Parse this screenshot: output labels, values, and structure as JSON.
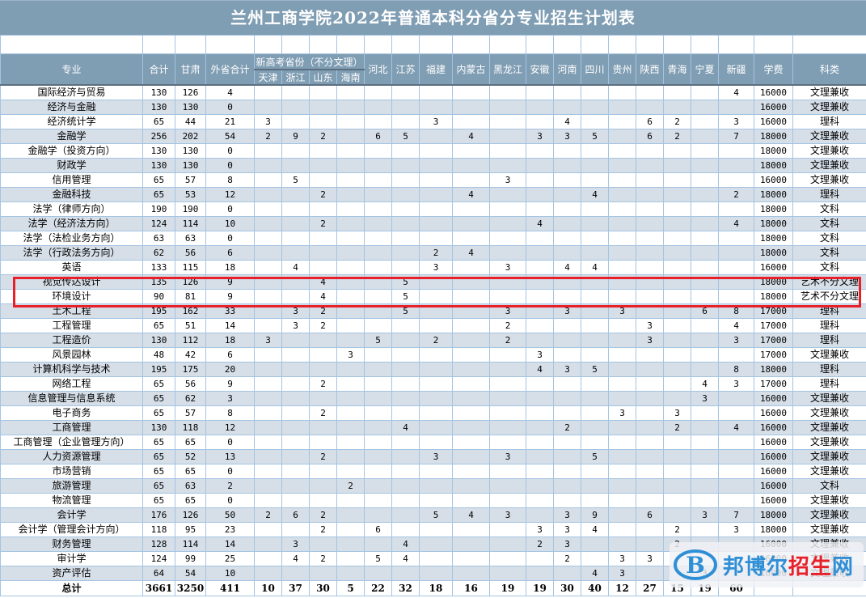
{
  "title": "兰州工商学院2022年普通本科分省分专业招生计划表",
  "headers": {
    "major": "专业",
    "total": "合计",
    "gansu": "甘肃",
    "out_total": "外省合计",
    "new_gaokao_group": "新高考省份（不分文理）",
    "new_gaokao_provinces": [
      "天津",
      "浙江",
      "山东",
      "海南"
    ],
    "other_provinces": [
      "河北",
      "江苏",
      "福建",
      "内蒙古",
      "黑龙江",
      "安徽",
      "河南",
      "四川",
      "贵州",
      "陕西",
      "青海",
      "宁夏",
      "新疆"
    ],
    "tuition": "学费",
    "category": "科类"
  },
  "province_order": [
    "天津",
    "浙江",
    "山东",
    "海南",
    "河北",
    "江苏",
    "福建",
    "内蒙古",
    "黑龙江",
    "安徽",
    "河南",
    "四川",
    "贵州",
    "陕西",
    "青海",
    "宁夏",
    "新疆"
  ],
  "rows": [
    {
      "major": "国际经济与贸易",
      "total": "130",
      "gansu": "126",
      "out_total": "4",
      "provinces": [
        "",
        "",
        "",
        "",
        "",
        "",
        "",
        "",
        "",
        "",
        "",
        "",
        "",
        "",
        "",
        "",
        "4"
      ],
      "tuition": "16000",
      "category": "文理兼收"
    },
    {
      "major": "经济与金融",
      "total": "130",
      "gansu": "130",
      "out_total": "0",
      "provinces": [
        "",
        "",
        "",
        "",
        "",
        "",
        "",
        "",
        "",
        "",
        "",
        "",
        "",
        "",
        "",
        "",
        ""
      ],
      "tuition": "16000",
      "category": "文理兼收"
    },
    {
      "major": "经济统计学",
      "total": "65",
      "gansu": "44",
      "out_total": "21",
      "provinces": [
        "3",
        "",
        "",
        "",
        "",
        "",
        "3",
        "",
        "",
        "",
        "4",
        "",
        "",
        "6",
        "2",
        "",
        "3"
      ],
      "tuition": "16000",
      "category": "理科"
    },
    {
      "major": "金融学",
      "total": "256",
      "gansu": "202",
      "out_total": "54",
      "provinces": [
        "2",
        "9",
        "2",
        "",
        "6",
        "5",
        "",
        "4",
        "",
        "3",
        "3",
        "5",
        "",
        "6",
        "2",
        "",
        "7"
      ],
      "tuition": "18000",
      "category": "文理兼收"
    },
    {
      "major": "金融学（投资方向）",
      "total": "130",
      "gansu": "130",
      "out_total": "0",
      "provinces": [
        "",
        "",
        "",
        "",
        "",
        "",
        "",
        "",
        "",
        "",
        "",
        "",
        "",
        "",
        "",
        "",
        ""
      ],
      "tuition": "18000",
      "category": "文理兼收"
    },
    {
      "major": "财政学",
      "total": "130",
      "gansu": "130",
      "out_total": "0",
      "provinces": [
        "",
        "",
        "",
        "",
        "",
        "",
        "",
        "",
        "",
        "",
        "",
        "",
        "",
        "",
        "",
        "",
        ""
      ],
      "tuition": "18000",
      "category": "文理兼收"
    },
    {
      "major": "信用管理",
      "total": "65",
      "gansu": "57",
      "out_total": "8",
      "provinces": [
        "",
        "5",
        "",
        "",
        "",
        "",
        "",
        "",
        "3",
        "",
        "",
        "",
        "",
        "",
        "",
        "",
        ""
      ],
      "tuition": "16000",
      "category": "文理兼收"
    },
    {
      "major": "金融科技",
      "total": "65",
      "gansu": "53",
      "out_total": "12",
      "provinces": [
        "",
        "",
        "2",
        "",
        "",
        "",
        "",
        "4",
        "",
        "",
        "",
        "4",
        "",
        "",
        "",
        "",
        "2"
      ],
      "tuition": "18000",
      "category": "理科"
    },
    {
      "major": "法学（律师方向）",
      "total": "190",
      "gansu": "190",
      "out_total": "0",
      "provinces": [
        "",
        "",
        "",
        "",
        "",
        "",
        "",
        "",
        "",
        "",
        "",
        "",
        "",
        "",
        "",
        "",
        ""
      ],
      "tuition": "18000",
      "category": "文科"
    },
    {
      "major": "法学（经济法方向）",
      "total": "124",
      "gansu": "114",
      "out_total": "10",
      "provinces": [
        "",
        "",
        "2",
        "",
        "",
        "",
        "",
        "",
        "",
        "4",
        "",
        "",
        "",
        "",
        "",
        "",
        "4"
      ],
      "tuition": "18000",
      "category": "文科"
    },
    {
      "major": "法学（法检业务方向）",
      "total": "63",
      "gansu": "63",
      "out_total": "0",
      "provinces": [
        "",
        "",
        "",
        "",
        "",
        "",
        "",
        "",
        "",
        "",
        "",
        "",
        "",
        "",
        "",
        "",
        ""
      ],
      "tuition": "18000",
      "category": "文科"
    },
    {
      "major": "法学（行政法务方向）",
      "total": "62",
      "gansu": "56",
      "out_total": "6",
      "provinces": [
        "",
        "",
        "",
        "",
        "",
        "",
        "2",
        "4",
        "",
        "",
        "",
        "",
        "",
        "",
        "",
        "",
        ""
      ],
      "tuition": "18000",
      "category": "文科"
    },
    {
      "major": "英语",
      "total": "133",
      "gansu": "115",
      "out_total": "18",
      "provinces": [
        "",
        "4",
        "",
        "",
        "",
        "",
        "3",
        "",
        "3",
        "",
        "4",
        "4",
        "",
        "",
        "",
        "",
        ""
      ],
      "tuition": "16000",
      "category": "文科"
    },
    {
      "major": "视觉传达设计",
      "total": "135",
      "gansu": "126",
      "out_total": "9",
      "provinces": [
        "",
        "",
        "4",
        "",
        "",
        "5",
        "",
        "",
        "",
        "",
        "",
        "",
        "",
        "",
        "",
        "",
        ""
      ],
      "tuition": "18000",
      "category": "艺术不分文理"
    },
    {
      "major": "环境设计",
      "total": "90",
      "gansu": "81",
      "out_total": "9",
      "provinces": [
        "",
        "",
        "4",
        "",
        "",
        "5",
        "",
        "",
        "",
        "",
        "",
        "",
        "",
        "",
        "",
        "",
        ""
      ],
      "tuition": "18000",
      "category": "艺术不分文理"
    },
    {
      "major": "土木工程",
      "total": "195",
      "gansu": "162",
      "out_total": "33",
      "provinces": [
        "",
        "3",
        "2",
        "",
        "",
        "5",
        "",
        "",
        "3",
        "",
        "3",
        "",
        "3",
        "",
        "",
        "6",
        "8"
      ],
      "tuition": "17000",
      "category": "理科"
    },
    {
      "major": "工程管理",
      "total": "65",
      "gansu": "51",
      "out_total": "14",
      "provinces": [
        "",
        "3",
        "2",
        "",
        "",
        "",
        "",
        "",
        "2",
        "",
        "",
        "",
        "",
        "3",
        "",
        "",
        "4"
      ],
      "tuition": "17000",
      "category": "理科"
    },
    {
      "major": "工程造价",
      "total": "130",
      "gansu": "112",
      "out_total": "18",
      "provinces": [
        "3",
        "",
        "",
        "",
        "5",
        "",
        "2",
        "",
        "2",
        "",
        "",
        "",
        "",
        "3",
        "",
        "",
        "3"
      ],
      "tuition": "17000",
      "category": "理科"
    },
    {
      "major": "风景园林",
      "total": "48",
      "gansu": "42",
      "out_total": "6",
      "provinces": [
        "",
        "",
        "",
        "3",
        "",
        "",
        "",
        "",
        "",
        "3",
        "",
        "",
        "",
        "",
        "",
        "",
        ""
      ],
      "tuition": "17000",
      "category": "文理兼收"
    },
    {
      "major": "计算机科学与技术",
      "total": "195",
      "gansu": "175",
      "out_total": "20",
      "provinces": [
        "",
        "",
        "",
        "",
        "",
        "",
        "",
        "",
        "",
        "4",
        "3",
        "5",
        "",
        "",
        "",
        "",
        "8"
      ],
      "tuition": "18000",
      "category": "理科"
    },
    {
      "major": "网络工程",
      "total": "65",
      "gansu": "56",
      "out_total": "9",
      "provinces": [
        "",
        "",
        "2",
        "",
        "",
        "",
        "",
        "",
        "",
        "",
        "",
        "",
        "",
        "",
        "",
        "4",
        "3"
      ],
      "tuition": "17000",
      "category": "理科"
    },
    {
      "major": "信息管理与信息系统",
      "total": "65",
      "gansu": "62",
      "out_total": "3",
      "provinces": [
        "",
        "",
        "",
        "",
        "",
        "",
        "",
        "",
        "",
        "",
        "",
        "",
        "",
        "",
        "",
        "3",
        ""
      ],
      "tuition": "16000",
      "category": "文理兼收"
    },
    {
      "major": "电子商务",
      "total": "65",
      "gansu": "57",
      "out_total": "8",
      "provinces": [
        "",
        "",
        "2",
        "",
        "",
        "",
        "",
        "",
        "",
        "",
        "",
        "",
        "3",
        "",
        "3",
        "",
        ""
      ],
      "tuition": "16000",
      "category": "文理兼收"
    },
    {
      "major": "工商管理",
      "total": "130",
      "gansu": "118",
      "out_total": "12",
      "provinces": [
        "",
        "",
        "",
        "",
        "",
        "4",
        "",
        "",
        "",
        "",
        "2",
        "",
        "",
        "",
        "2",
        "",
        "4"
      ],
      "tuition": "16000",
      "category": "文理兼收"
    },
    {
      "major": "工商管理（企业管理方向）",
      "total": "65",
      "gansu": "65",
      "out_total": "0",
      "provinces": [
        "",
        "",
        "",
        "",
        "",
        "",
        "",
        "",
        "",
        "",
        "",
        "",
        "",
        "",
        "",
        "",
        ""
      ],
      "tuition": "16000",
      "category": "文理兼收"
    },
    {
      "major": "人力资源管理",
      "total": "65",
      "gansu": "52",
      "out_total": "13",
      "provinces": [
        "",
        "",
        "2",
        "",
        "",
        "",
        "3",
        "",
        "3",
        "",
        "",
        "5",
        "",
        "",
        "",
        "",
        ""
      ],
      "tuition": "16000",
      "category": "文理兼收"
    },
    {
      "major": "市场营销",
      "total": "65",
      "gansu": "65",
      "out_total": "0",
      "provinces": [
        "",
        "",
        "",
        "",
        "",
        "",
        "",
        "",
        "",
        "",
        "",
        "",
        "",
        "",
        "",
        "",
        ""
      ],
      "tuition": "16000",
      "category": "文理兼收"
    },
    {
      "major": "旅游管理",
      "total": "65",
      "gansu": "63",
      "out_total": "2",
      "provinces": [
        "",
        "",
        "",
        "2",
        "",
        "",
        "",
        "",
        "",
        "",
        "",
        "",
        "",
        "",
        "",
        "",
        ""
      ],
      "tuition": "16000",
      "category": "文科"
    },
    {
      "major": "物流管理",
      "total": "65",
      "gansu": "65",
      "out_total": "0",
      "provinces": [
        "",
        "",
        "",
        "",
        "",
        "",
        "",
        "",
        "",
        "",
        "",
        "",
        "",
        "",
        "",
        "",
        ""
      ],
      "tuition": "16000",
      "category": "文理兼收"
    },
    {
      "major": "会计学",
      "total": "176",
      "gansu": "126",
      "out_total": "50",
      "provinces": [
        "2",
        "6",
        "2",
        "",
        "",
        "",
        "5",
        "4",
        "3",
        "",
        "3",
        "9",
        "",
        "6",
        "",
        "3",
        "7"
      ],
      "tuition": "18000",
      "category": "文理兼收"
    },
    {
      "major": "会计学（管理会计方向）",
      "total": "118",
      "gansu": "95",
      "out_total": "23",
      "provinces": [
        "",
        "",
        "2",
        "",
        "6",
        "",
        "",
        "",
        "",
        "3",
        "3",
        "4",
        "",
        "",
        "2",
        "",
        "3"
      ],
      "tuition": "18000",
      "category": "文理兼收"
    },
    {
      "major": "财务管理",
      "total": "128",
      "gansu": "114",
      "out_total": "14",
      "provinces": [
        "",
        "3",
        "",
        "",
        "",
        "4",
        "",
        "",
        "",
        "2",
        "3",
        "",
        "",
        "",
        "2",
        "",
        ""
      ],
      "tuition": "16000",
      "category": "文理兼收"
    },
    {
      "major": "审计学",
      "total": "124",
      "gansu": "99",
      "out_total": "25",
      "provinces": [
        "",
        "4",
        "2",
        "",
        "5",
        "4",
        "",
        "",
        "",
        "",
        "2",
        "",
        "3",
        "3",
        "",
        "",
        ""
      ],
      "tuition": "16000",
      "category": "文理兼收"
    },
    {
      "major": "资产评估",
      "total": "64",
      "gansu": "54",
      "out_total": "10",
      "provinces": [
        "",
        "",
        "",
        "",
        "",
        "",
        "",
        "",
        "",
        "",
        "",
        "4",
        "3",
        "",
        "",
        "3",
        ""
      ],
      "tuition": "16000",
      "category": "文理兼收"
    }
  ],
  "totals": {
    "label": "总计",
    "total": "3661",
    "gansu": "3250",
    "out_total": "411",
    "provinces": [
      "10",
      "37",
      "30",
      "5",
      "22",
      "32",
      "18",
      "16",
      "19",
      "19",
      "30",
      "40",
      "12",
      "27",
      "15",
      "19",
      "60"
    ],
    "tuition": "",
    "category": ""
  },
  "highlighted_majors": [
    "视觉传达设计",
    "环境设计"
  ],
  "watermark": {
    "logo_letter": "B",
    "text_blue": "邦博尔",
    "text_red": "招生",
    "text_blue2": "网"
  },
  "colors": {
    "header_bg": "#7f9db3",
    "stripe": "#d6dee7",
    "grid": "#a4c4e2",
    "highlight": "#e8202a",
    "watermark_blue": "#2f8fd6"
  }
}
